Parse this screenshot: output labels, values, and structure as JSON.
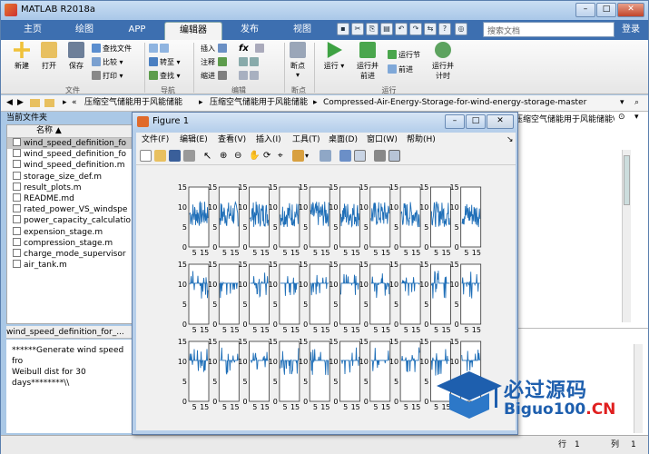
{
  "window": {
    "title": "MATLAB R2018a"
  },
  "tabs": [
    "主页",
    "绘图",
    "APP",
    "编辑器",
    "发布",
    "视图"
  ],
  "active_tab": "编辑器",
  "search": {
    "placeholder": "搜索文档"
  },
  "login_label": "登录",
  "ribbon": {
    "file": {
      "new": "新建",
      "open": "打开",
      "save": "保存",
      "find_files": "查找文件",
      "compare": "比较",
      "print": "打印",
      "group": "文件"
    },
    "nav": {
      "goto": "转至",
      "find": "查找",
      "group": "导航"
    },
    "edit": {
      "insert": "插入",
      "comment": "注释",
      "indent": "缩进",
      "fx": "fx",
      "group": "编辑"
    },
    "breakpoints": {
      "label": "断点",
      "group": "断点"
    },
    "run": {
      "run": "运行",
      "run_advance": "运行并前进",
      "run_section": "运行节",
      "advance": "前进",
      "run_time": "运行并计时",
      "group": "运行"
    }
  },
  "path": {
    "crumbs": [
      "压缩空气储能用于风能储能",
      "压缩空气储能用于风能储能",
      "Compressed-Air-Energy-Storage-for-wind-energy-storage-master"
    ]
  },
  "current_folder": {
    "title": "当前文件夹",
    "column": "名称",
    "files": [
      "wind_speed_definition_fo",
      "wind_speed_definition_fo",
      "wind_speed_definition.m",
      "storage_size_def.m",
      "result_plots.m",
      "README.md",
      "rated_power_VS_windspe",
      "power_capacity_calculatio",
      "expension_stage.m",
      "compression_stage.m",
      "charge_mode_supervisor",
      "air_tank.m"
    ]
  },
  "detail": {
    "title": "wind_speed_definition_for_...",
    "text": [
      "******Generate wind speed fro",
      "Weibull dist for 30",
      "days********\\\\"
    ]
  },
  "workspace_path": "压缩空气储能用于风能储能\\...",
  "status": {
    "row_label": "行",
    "row": "1",
    "col_label": "列",
    "col": "1"
  },
  "figure": {
    "title": "Figure 1",
    "menu": [
      "文件(F)",
      "编辑(E)",
      "查看(V)",
      "插入(I)",
      "工具(T)",
      "桌面(D)",
      "窗口(W)",
      "帮助(H)"
    ],
    "y_ticks": [
      "15",
      "10",
      "5",
      "0"
    ],
    "x_ticks": [
      "5",
      "15"
    ]
  },
  "watermark": {
    "line1": "必过源码",
    "line2_main": "Biguo100",
    "line2_tld": ".CN"
  },
  "colors": {
    "tab_bar": "#3d6fb0",
    "plot_line": "#1f6fb8",
    "watermark": "#1e5fae"
  }
}
